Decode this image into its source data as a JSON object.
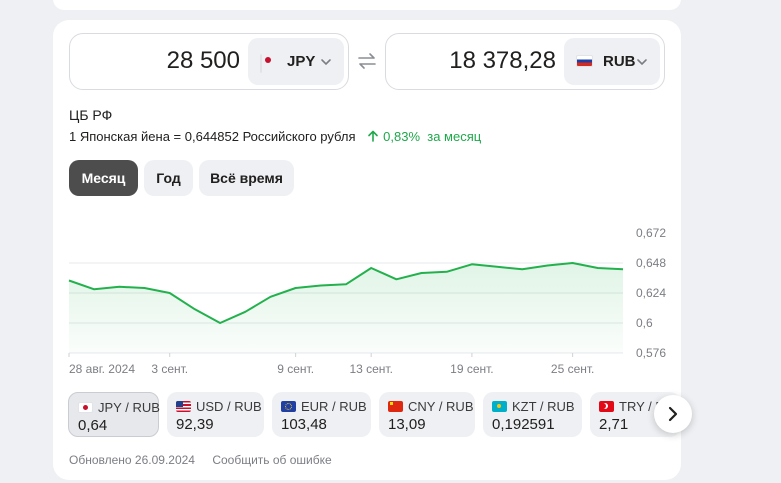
{
  "converter": {
    "from_amount": "28 500",
    "from_currency": "JPY",
    "to_amount": "18 378,28",
    "to_currency": "RUB"
  },
  "rate_info": {
    "source": "ЦБ РФ",
    "rate_text": "1 Японская йена = 0,644852 Российского рубля",
    "change": "0,83%",
    "change_period": "за месяц"
  },
  "periods": [
    "Месяц",
    "Год",
    "Всё время"
  ],
  "active_period": "Месяц",
  "chart_data": {
    "type": "area",
    "x": [
      "2024-08-28",
      "2024-08-29",
      "2024-08-30",
      "2024-08-31",
      "2024-09-03",
      "2024-09-04",
      "2024-09-05",
      "2024-09-06",
      "2024-09-07",
      "2024-09-10",
      "2024-09-11",
      "2024-09-12",
      "2024-09-13",
      "2024-09-14",
      "2024-09-17",
      "2024-09-18",
      "2024-09-19",
      "2024-09-20",
      "2024-09-21",
      "2024-09-24",
      "2024-09-25",
      "2024-09-26",
      "2024-09-27"
    ],
    "values": [
      0.634,
      0.627,
      0.629,
      0.628,
      0.624,
      0.611,
      0.6,
      0.609,
      0.621,
      0.628,
      0.63,
      0.631,
      0.644,
      0.635,
      0.64,
      0.641,
      0.647,
      0.645,
      0.643,
      0.646,
      0.648,
      0.644,
      0.643
    ],
    "x_tick_labels": [
      "28 авг. 2024",
      "3 сент.",
      "9 сент.",
      "13 сент.",
      "19 сент.",
      "25 сент."
    ],
    "x_tick_index": [
      0,
      4,
      9,
      12,
      16,
      20
    ],
    "y_ticks": [
      "0,672",
      "0,648",
      "0,624",
      "0,6",
      "0,576"
    ],
    "y_tick_values": [
      0.672,
      0.648,
      0.624,
      0.6,
      0.576
    ],
    "ylim": [
      0.576,
      0.672
    ],
    "grid": true,
    "color": "#22b14c"
  },
  "pairs": [
    {
      "label": "JPY / RUB",
      "value": "0,64",
      "flag": "jp",
      "selected": true
    },
    {
      "label": "USD / RUB",
      "value": "92,39",
      "flag": "us",
      "selected": false
    },
    {
      "label": "EUR / RUB",
      "value": "103,48",
      "flag": "eu",
      "selected": false
    },
    {
      "label": "CNY / RUB",
      "value": "13,09",
      "flag": "cn",
      "selected": false
    },
    {
      "label": "KZT / RUB",
      "value": "0,192591",
      "flag": "kz",
      "selected": false
    },
    {
      "label": "TRY / RUB",
      "value": "2,71",
      "flag": "tr",
      "selected": false
    }
  ],
  "footer": {
    "updated": "Обновлено 26.09.2024",
    "report": "Сообщить об ошибке"
  }
}
